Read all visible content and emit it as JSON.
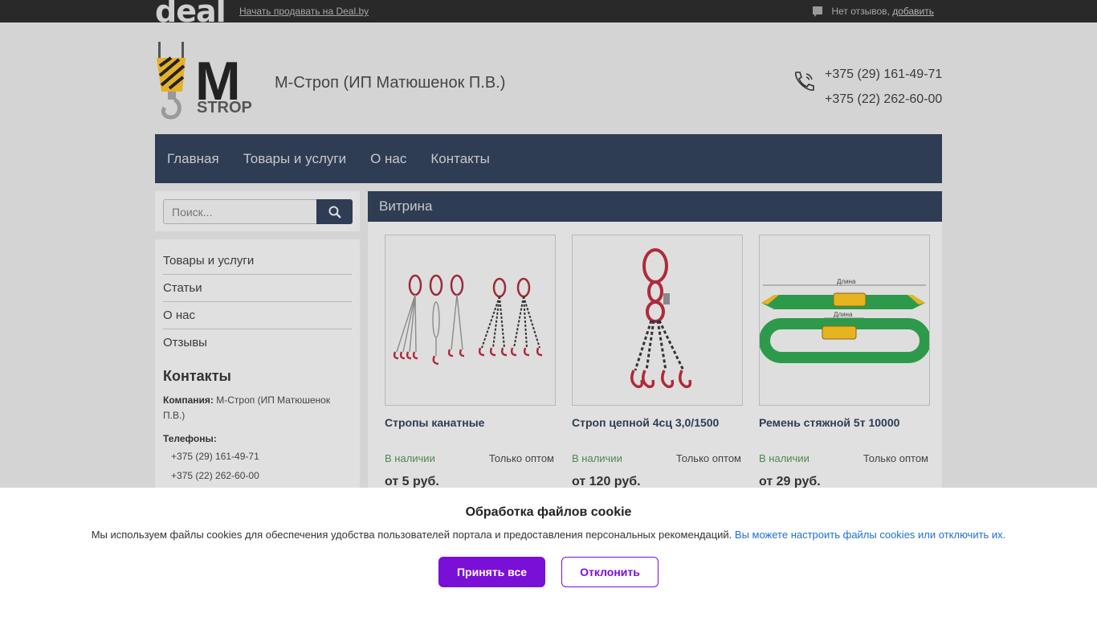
{
  "topbar": {
    "logo": "deal",
    "sell_link": "Начать продавать на Deal.by",
    "reviews_text": "Нет отзывов,",
    "reviews_add": "добавить"
  },
  "header": {
    "company_name": "М-Строп (ИП Матюшенок П.В.)",
    "phones": [
      "+375 (29) 161-49-71",
      "+375 (22) 262-60-00"
    ],
    "logo_letter": "M",
    "logo_word": "STROP"
  },
  "nav": {
    "items": [
      "Главная",
      "Товары и услуги",
      "О нас",
      "Контакты"
    ]
  },
  "search": {
    "placeholder": "Поиск..."
  },
  "sidebar": {
    "menu": [
      "Товары и услуги",
      "Статьи",
      "О нас",
      "Отзывы"
    ],
    "contacts_title": "Контакты",
    "company_label": "Компания:",
    "company_value": "М-Строп (ИП Матюшенок П.В.)",
    "phones_label": "Телефоны:",
    "phones": [
      "+375 (29) 161-49-71",
      "+375 (22) 262-60-00"
    ]
  },
  "showcase": {
    "title": "Витрина",
    "products": [
      {
        "title": "Стропы канатные",
        "stock": "В наличии",
        "wholesale": "Только оптом",
        "price": "от 5 руб."
      },
      {
        "title": "Строп цепной 4сц 3,0/1500",
        "stock": "В наличии",
        "wholesale": "Только оптом",
        "price": "от 120 руб."
      },
      {
        "title": "Ремень стяжной 5т 10000",
        "stock": "В наличии",
        "wholesale": "Только оптом",
        "price": "от 29 руб."
      }
    ],
    "image_labels": [
      "Длина",
      "Длина"
    ]
  },
  "cookie": {
    "title": "Обработка файлов cookie",
    "text": "Мы используем файлы cookies для обеспечения удобства пользователей портала и предоставления персональных рекомендаций.",
    "link": "Вы можете настроить файлы cookies или отключить их.",
    "accept": "Принять все",
    "decline": "Отклонить"
  },
  "colors": {
    "nav_bg": "#2e3c54",
    "accent_purple": "#7a0fd8",
    "stock_green": "#4c8a4c",
    "link_blue": "#1f6fd6"
  }
}
